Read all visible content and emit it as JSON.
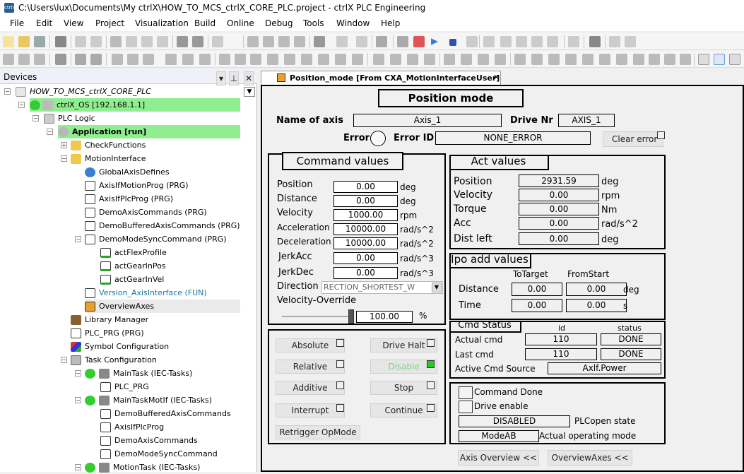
{
  "window": {
    "title": "C:\\Users\\lux\\Documents\\My ctrlX\\HOW_TO_MCS_ctrlX_CORE_PLC.project - ctrlX PLC Engineering",
    "app_icon_label": "ctrlX"
  },
  "menu": [
    "File",
    "Edit",
    "View",
    "Project",
    "Visualization",
    "Build",
    "Online",
    "Debug",
    "Tools",
    "Window",
    "Help"
  ],
  "devices": {
    "header": "Devices",
    "tree": [
      {
        "label": "HOW_TO_MCS_ctrlX_CORE_PLC",
        "icon": "project-icon"
      },
      {
        "label": "ctrlX_OS  [192.168.1.1]",
        "icon": "device-icon"
      },
      {
        "label": "PLC Logic",
        "icon": "plc-logic-icon"
      },
      {
        "label": "Application [run]",
        "icon": "application-icon"
      },
      {
        "label": "CheckFunctions",
        "icon": "folder-icon"
      },
      {
        "label": "MotionInterface",
        "icon": "folder-icon"
      },
      {
        "label": "GlobalAxisDefines",
        "icon": "globe-icon"
      },
      {
        "label": "AxisIfMotionProg (PRG)",
        "icon": "pou-icon"
      },
      {
        "label": "AxisIfPlcProg (PRG)",
        "icon": "pou-icon"
      },
      {
        "label": "DemoAxisCommands (PRG)",
        "icon": "pou-icon"
      },
      {
        "label": "DemoBufferedAxisCommands (PRG)",
        "icon": "pou-icon"
      },
      {
        "label": "DemoModeSyncCommand (PRG)",
        "icon": "pou-icon"
      },
      {
        "label": "actFlexProfile",
        "icon": "action-icon"
      },
      {
        "label": "actGearInPos",
        "icon": "action-icon"
      },
      {
        "label": "actGearInVel",
        "icon": "action-icon"
      },
      {
        "label": "Version_AxisInterface (FUN)",
        "icon": "pou-icon"
      },
      {
        "label": "OverviewAxes",
        "icon": "visu-icon"
      },
      {
        "label": "Library Manager",
        "icon": "library-icon"
      },
      {
        "label": "PLC_PRG (PRG)",
        "icon": "pou-icon"
      },
      {
        "label": "Symbol Configuration",
        "icon": "symbol-icon"
      },
      {
        "label": "Task Configuration",
        "icon": "task-config-icon"
      },
      {
        "label": "MainTask (IEC-Tasks)",
        "icon": "task-icon"
      },
      {
        "label": "PLC_PRG",
        "icon": "call-icon"
      },
      {
        "label": "MainTaskMotIf (IEC-Tasks)",
        "icon": "task-icon"
      },
      {
        "label": "DemoBufferedAxisCommands",
        "icon": "call-icon"
      },
      {
        "label": "AxisIfPlcProg",
        "icon": "call-icon"
      },
      {
        "label": "DemoAxisCommands",
        "icon": "call-icon"
      },
      {
        "label": "DemoModeSyncCommand",
        "icon": "call-icon"
      },
      {
        "label": "MotionTask (IEC-Tasks)",
        "icon": "task-icon"
      }
    ]
  },
  "editor": {
    "tab_label": "Position_mode [From CXA_MotionInterfaceUser]",
    "heading": "Position mode",
    "name_of_axis_label": "Name of axis",
    "name_of_axis_value": "Axis_1",
    "drive_nr_label": "Drive Nr",
    "drive_nr_value": "AXIS_1",
    "error_label": "Error",
    "error_id_label": "Error ID",
    "error_id_value": "NONE_ERROR",
    "clear_error": "Clear error",
    "command_values": {
      "heading": "Command values",
      "rows": [
        {
          "label": "Position",
          "value": "0.00",
          "unit": "deg"
        },
        {
          "label": "Distance",
          "value": "0.00",
          "unit": "deg"
        },
        {
          "label": "Velocity",
          "value": "1000.00",
          "unit": "rpm"
        },
        {
          "label": "Acceleration",
          "value": "10000.00",
          "unit": "rad/s^2"
        },
        {
          "label": "Deceleration",
          "value": "10000.00",
          "unit": "rad/s^2"
        },
        {
          "label": "JerkAcc",
          "value": "0.00",
          "unit": "rad/s^3"
        },
        {
          "label": "JerkDec",
          "value": "0.00",
          "unit": "rad/s^3"
        }
      ],
      "direction_label": "Direction",
      "direction_value": "RECTION_SHORTEST_W",
      "override_label": "Velocity-Override",
      "override_value": "100.00",
      "override_unit": "%",
      "override_level": 1.0
    },
    "act_values": {
      "heading": "Act values",
      "rows": [
        {
          "label": "Position",
          "value": "2931.59",
          "unit": "deg"
        },
        {
          "label": "Velocity",
          "value": "0.00",
          "unit": "rpm"
        },
        {
          "label": "Torque",
          "value": "0.00",
          "unit": "Nm"
        },
        {
          "label": "Acc",
          "value": "0.00",
          "unit": "rad/s^2"
        },
        {
          "label": "Dist left",
          "value": "0.00",
          "unit": "deg"
        }
      ]
    },
    "ipo": {
      "heading": "Ipo add values",
      "col1": "ToTarget",
      "col2": "FromStart",
      "rows": [
        {
          "label": "Distance",
          "v1": "0.00",
          "v2": "0.00",
          "unit": "deg"
        },
        {
          "label": "Time",
          "v1": "0.00",
          "v2": "0.00",
          "unit": "s"
        }
      ]
    },
    "buttons": {
      "absolute": "Absolute",
      "relative": "Relative",
      "additive": "Additive",
      "interrupt": "Interrupt",
      "retrigger": "Retrigger OpMode",
      "drive_halt": "Drive Halt",
      "disable": "Disable",
      "stop": "Stop",
      "continue": "Continue"
    },
    "cmd_status": {
      "heading": "Cmd Status",
      "col_id": "id",
      "col_status": "status",
      "actual_label": "Actual cmd",
      "actual_id": "110",
      "actual_status": "DONE",
      "last_label": "Last cmd",
      "last_id": "110",
      "last_status": "DONE",
      "source_label": "Active Cmd Source",
      "source_value": "Axlf.Power"
    },
    "state": {
      "command_done": "Command Done",
      "drive_enable": "Drive enable",
      "plcopen_value": "DISABLED",
      "plcopen_label": "PLCopen state",
      "opmode_value": "ModeAB",
      "opmode_label": "Actual operating mode"
    },
    "nav_axis_overview": "Axis Overview <<",
    "nav_overview_axes": "OverviewAxes <<"
  },
  "colors": {
    "highlight": "#90ee90",
    "led_on": "#22cc22",
    "disabled_text": "#7ed27e"
  }
}
